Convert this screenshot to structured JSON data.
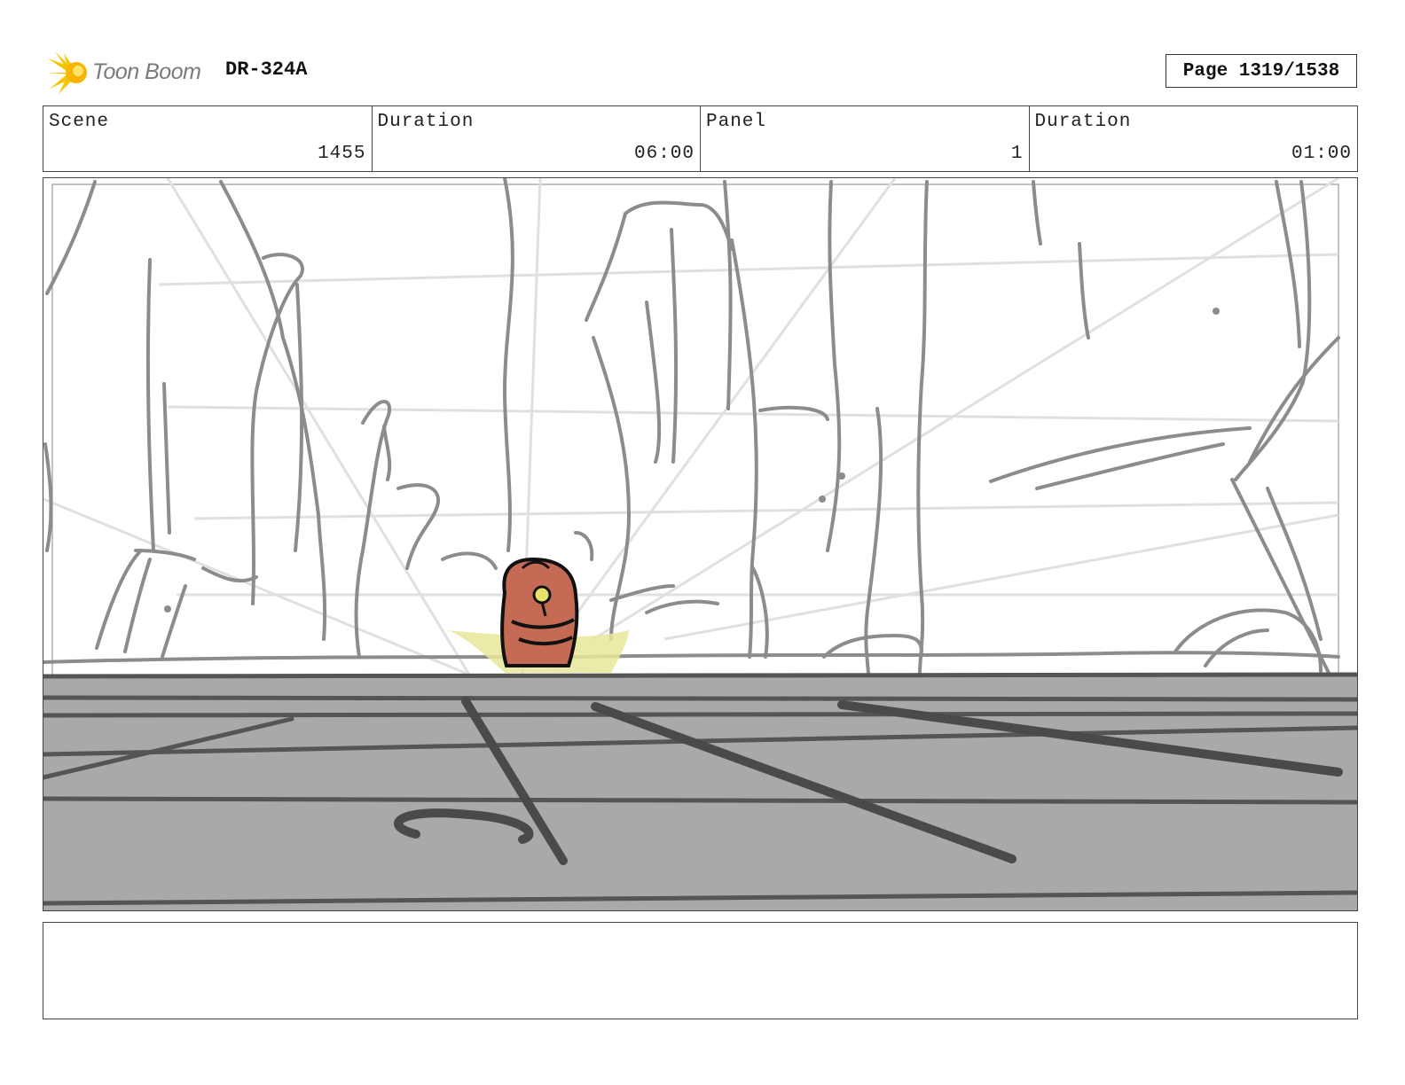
{
  "header": {
    "logo_text": "Toon Boom",
    "production_code": "DR-324A",
    "page_label": "Page 1319/1538"
  },
  "info": {
    "scene_label": "Scene",
    "scene_value": "1455",
    "scene_duration_label": "Duration",
    "scene_duration_value": "06:00",
    "panel_label": "Panel",
    "panel_value": "1",
    "panel_duration_label": "Duration",
    "panel_duration_value": "01:00"
  },
  "notes": {
    "text": ""
  },
  "colors": {
    "logo_yellow": "#f5c400",
    "floor_gray": "#a9a9ab",
    "sketch_gray": "#8a8a8a",
    "character_red": "#c46a55",
    "highlight_yellow": "#e8e89a"
  }
}
